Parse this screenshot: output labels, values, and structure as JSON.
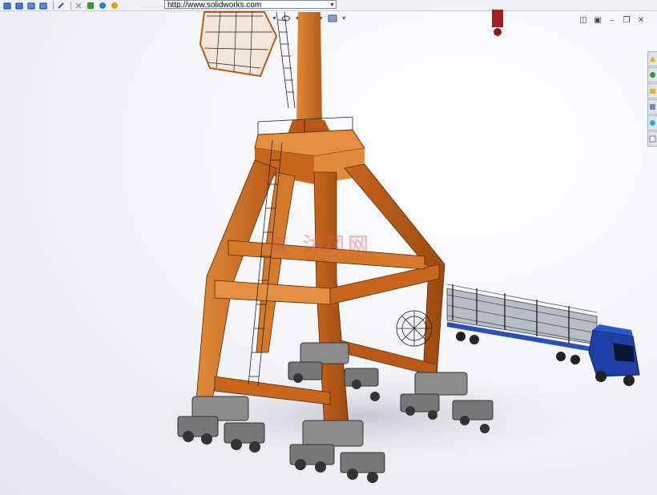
{
  "toolbar": {
    "url": "http://www.solidworks.com",
    "icons": [
      "view-cube-icon",
      "view-cube-icon",
      "view-cube-icon",
      "view-cube-icon",
      "link-icon",
      "close-icon",
      "refresh-icon",
      "home-icon",
      "globe-icon"
    ]
  },
  "heads_up": {
    "icons": [
      "zoom-icon",
      "section-icon",
      "view-orientation-icon",
      "display-style-icon",
      "hide-show-icon",
      "appearance-icon",
      "scene-icon"
    ]
  },
  "window_controls": [
    "tile-icon",
    "cascade-icon",
    "minimize-icon",
    "restore-icon",
    "close-icon"
  ],
  "window_control_glyphs": [
    "◫",
    "▣",
    "–",
    "❐",
    "✕"
  ],
  "task_pane": [
    "resources-icon",
    "design-library-icon",
    "file-explorer-icon",
    "view-palette-icon",
    "appearances-icon",
    "custom-properties-icon"
  ],
  "watermark": {
    "cn": "沐风网",
    "en": "www.mfcad.com"
  },
  "colors": {
    "crane_orange": "#c8661c",
    "truck_blue": "#1e3fa8",
    "wheel_gray": "#8c8c8c"
  }
}
